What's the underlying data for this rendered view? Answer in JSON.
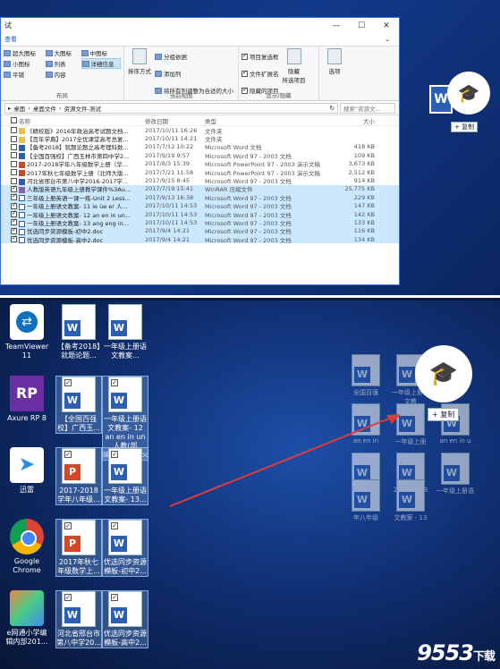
{
  "explorer": {
    "title": "试",
    "menu": [
      "查看"
    ],
    "window_buttons": [
      "—",
      "☐",
      "✕"
    ],
    "ribbon": {
      "layout_items": [
        "超大图标",
        "大图标",
        "中图标",
        "小图标",
        "列表",
        "详细信息",
        "平铺",
        "内容"
      ],
      "layout_selected": "详细信息",
      "layout_group_label": "布局",
      "sort_button": "排序方式",
      "view_items": [
        "分组依据",
        "添加列",
        "将所有列调整为合适的大小"
      ],
      "current_view_label": "当前视图",
      "show_items": [
        {
          "label": "项目复选框",
          "checked": true
        },
        {
          "label": "文件扩展名",
          "checked": true
        },
        {
          "label": "隐藏的项目",
          "checked": true
        }
      ],
      "hide_button": "隐藏",
      "hide_selected": "所选项目",
      "options_button": "选项",
      "show_hide_label": "显示/隐藏"
    },
    "address": {
      "path": [
        "桌面",
        "桌面文件",
        "资源文件-测试"
      ],
      "search_placeholder": "搜索\"资源文..."
    },
    "columns": {
      "name": "名称",
      "date": "修改日期",
      "type": "类型",
      "size": "大小"
    },
    "files": [
      {
        "name": "《精校版》2016年政治高考试题文档...",
        "date": "2017/10/11 16:26",
        "type": "文件夹",
        "size": "",
        "icon": "folder",
        "selected": false,
        "checked": false
      },
      {
        "name": "【百年学典】2017全优课堂高考总复...",
        "date": "2017/10/11 14:21",
        "type": "文件夹",
        "size": "",
        "icon": "folder",
        "selected": false,
        "checked": false
      },
      {
        "name": "【备考2018】就题论题之高考理科数...",
        "date": "2017/7/12 10:22",
        "type": "Microsoft Word 文档",
        "size": "418 KB",
        "icon": "word",
        "selected": false,
        "checked": false
      },
      {
        "name": "【全国百强校】广西玉林市第四中学2...",
        "date": "2017/9/19 9:57",
        "type": "Microsoft Word 97 - 2003 文档",
        "size": "109 KB",
        "icon": "word",
        "selected": false,
        "checked": false
      },
      {
        "name": "2017-2018学年八年级数学上册（华...",
        "date": "2017/8/3 15:39",
        "type": "Microsoft PowerPoint 97 - 2003 演示文稿",
        "size": "3,673 KB",
        "icon": "ppt",
        "selected": false,
        "checked": false
      },
      {
        "name": "2017年秋七年级数学上册（北师大版...",
        "date": "2017/7/21 11:58",
        "type": "Microsoft PowerPoint 97 - 2003 演示文稿",
        "size": "2,512 KB",
        "icon": "ppt",
        "selected": false,
        "checked": false
      },
      {
        "name": "河北省邢台市第八中学2016-2017学...",
        "date": "2017/9/15 8:45",
        "type": "Microsoft Word 97 - 2003 文档",
        "size": "914 KB",
        "icon": "word",
        "selected": false,
        "checked": false
      },
      {
        "name": "人教版英语九年级上册教学课件%3Au...",
        "date": "2017/7/19 15:41",
        "type": "WinRAR 压缩文件",
        "size": "25,775 KB",
        "icon": "rar",
        "selected": true,
        "checked": true
      },
      {
        "name": "三年级上册英语一课一练-Unit 2 Less...",
        "date": "2017/9/13 16:38",
        "type": "Microsoft Word 97 - 2003 文档",
        "size": "229 KB",
        "icon": "doc",
        "selected": true,
        "checked": true
      },
      {
        "name": "一年级上册语文教案- 11 ie üe er 人...",
        "date": "2017/10/11 14:53",
        "type": "Microsoft Word 97 - 2003 文档",
        "size": "147 KB",
        "icon": "doc",
        "selected": true,
        "checked": true
      },
      {
        "name": "一年级上册语文教案- 12 an en in un...",
        "date": "2017/10/11 14:53",
        "type": "Microsoft Word 97 - 2003 文档",
        "size": "142 KB",
        "icon": "doc",
        "selected": true,
        "checked": true
      },
      {
        "name": "一年级上册语文教案- 13 ang eng in...",
        "date": "2017/10/11 14:53",
        "type": "Microsoft Word 97 - 2003 文档",
        "size": "133 KB",
        "icon": "doc",
        "selected": true,
        "checked": true
      },
      {
        "name": "优选同步资源模板-初中2.doc",
        "date": "2017/9/4 14:21",
        "type": "Microsoft Word 97 - 2003 文档",
        "size": "116 KB",
        "icon": "doc",
        "selected": true,
        "checked": true
      },
      {
        "name": "优选同步资源模板-高中2.doc",
        "date": "2017/9/4 14:21",
        "type": "Microsoft Word 97 - 2003 文档",
        "size": "134 KB",
        "icon": "doc",
        "selected": true,
        "checked": true
      }
    ]
  },
  "drag_badge": "+ 复制",
  "desktop": {
    "icons": [
      {
        "label": "TeamViewer 11",
        "kind": "teamviewer",
        "selected": false
      },
      {
        "label": "【备考2018】就题论题...",
        "kind": "word",
        "selected": false
      },
      {
        "label": "一年级上册语文教案...",
        "kind": "word",
        "selected": false
      },
      {
        "label": "Axure RP 8",
        "kind": "axure",
        "selected": false
      },
      {
        "label": "【全国百强校】广西玉...",
        "kind": "word",
        "selected": true
      },
      {
        "label": "一年级上册语文教案- 12 an en in un 人教(部编)2016).doc",
        "kind": "word",
        "selected": true
      },
      {
        "label": "迅雷",
        "kind": "xunlei",
        "selected": false
      },
      {
        "label": "2017-2018学年八年级...",
        "kind": "ppt",
        "selected": true
      },
      {
        "label": "一年级上册语文教案- 13...",
        "kind": "word",
        "selected": true
      },
      {
        "label": "Google Chrome",
        "kind": "chrome",
        "selected": false
      },
      {
        "label": "2017年秋七年级数学上...",
        "kind": "ppt",
        "selected": true
      },
      {
        "label": "优选同步资源模板-初中2...",
        "kind": "word",
        "selected": true
      },
      {
        "label": "e网通小学编辑内部201...",
        "kind": "ewang",
        "selected": false
      },
      {
        "label": "河北省邢台市第八中学20...",
        "kind": "word",
        "selected": true
      },
      {
        "label": "优选同步资源模板-高中2...",
        "kind": "word",
        "selected": true
      }
    ],
    "ghost_labels": [
      "全国百强",
      "一年级上册语文教",
      "an en in",
      "一年级上册",
      "an en in u",
      "0",
      "2017-2018",
      "一年级上册语",
      "年八年级",
      "文教案 - 13"
    ],
    "drag_badge": "+ 复制",
    "watermark_main": "9553",
    "watermark_sub": "下载"
  }
}
